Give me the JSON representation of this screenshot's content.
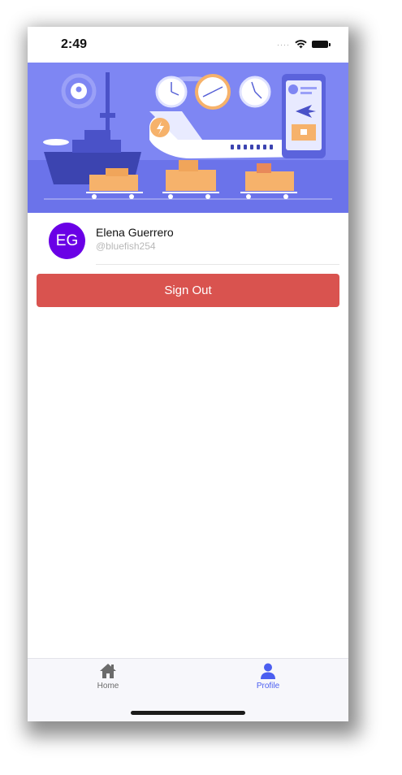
{
  "status_bar": {
    "time": "2:49",
    "signal_icon": "signal-dots-icon",
    "wifi_icon": "wifi-icon",
    "battery_icon": "battery-icon"
  },
  "hero": {
    "illustration": "cargo-airport-illustration",
    "colors": {
      "background": "#7e86f3",
      "accent": "#f6b26b",
      "dark": "#3c44b0"
    }
  },
  "profile": {
    "initials": "EG",
    "name": "Elena Guerrero",
    "handle": "@bluefish254",
    "avatar_color": "#6a00e6"
  },
  "actions": {
    "sign_out_label": "Sign Out",
    "sign_out_color": "#d9534f"
  },
  "tab_bar": {
    "tabs": [
      {
        "label": "Home",
        "icon": "home-icon",
        "active": false
      },
      {
        "label": "Profile",
        "icon": "person-icon",
        "active": true
      }
    ],
    "active_color": "#4b5ef0"
  }
}
